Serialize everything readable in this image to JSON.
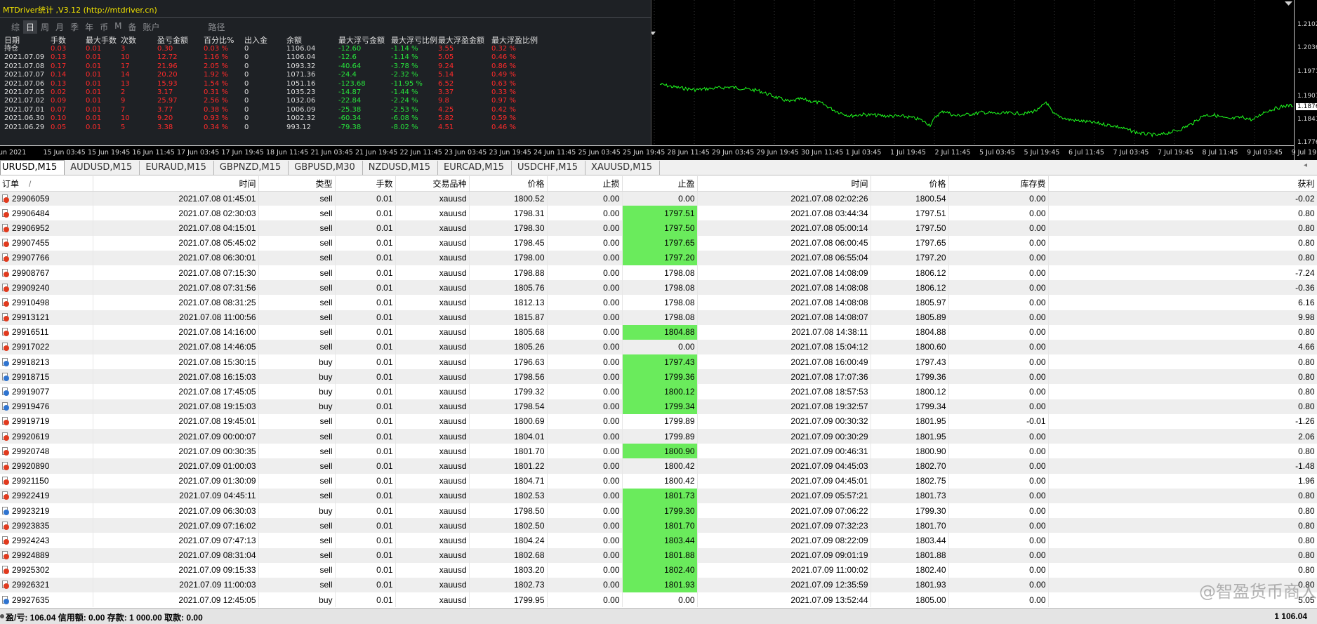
{
  "stats_panel": {
    "title": "MTDriver统计 ,V3.12 (http://mtdriver.cn)",
    "tabs": [
      "综",
      "日",
      "周",
      "月",
      "季",
      "年",
      "币",
      "M",
      "备",
      "账户"
    ],
    "active_tab": "日",
    "path_label": "路径",
    "headers": [
      "日期",
      "手数",
      "最大手数",
      "次数",
      "盈亏金额",
      "百分比%",
      "出入金",
      "余额",
      "最大浮亏金额",
      "最大浮亏比例",
      "最大浮盈金额",
      "最大浮盈比例"
    ],
    "rows": [
      [
        "持仓",
        "0.03",
        "0.01",
        "3",
        "0.30",
        "0.03 %",
        "0",
        "1106.04",
        "-12.60",
        "-1.14 %",
        "3.55",
        "0.32 %"
      ],
      [
        "2021.07.09",
        "0.13",
        "0.01",
        "10",
        "12.72",
        "1.16 %",
        "0",
        "1106.04",
        "-12.6",
        "-1.14 %",
        "5.05",
        "0.46 %"
      ],
      [
        "2021.07.08",
        "0.17",
        "0.01",
        "17",
        "21.96",
        "2.05 %",
        "0",
        "1093.32",
        "-40.64",
        "-3.78 %",
        "9.24",
        "0.86 %"
      ],
      [
        "2021.07.07",
        "0.14",
        "0.01",
        "14",
        "20.20",
        "1.92 %",
        "0",
        "1071.36",
        "-24.4",
        "-2.32 %",
        "5.14",
        "0.49 %"
      ],
      [
        "2021.07.06",
        "0.13",
        "0.01",
        "13",
        "15.93",
        "1.54 %",
        "0",
        "1051.16",
        "-123.68",
        "-11.95 %",
        "6.52",
        "0.63 %"
      ],
      [
        "2021.07.05",
        "0.02",
        "0.01",
        "2",
        "3.17",
        "0.31 %",
        "0",
        "1035.23",
        "-14.87",
        "-1.44 %",
        "3.37",
        "0.33 %"
      ],
      [
        "2021.07.02",
        "0.09",
        "0.01",
        "9",
        "25.97",
        "2.56 %",
        "0",
        "1032.06",
        "-22.84",
        "-2.24 %",
        "9.8",
        "0.97 %"
      ],
      [
        "2021.07.01",
        "0.07",
        "0.01",
        "7",
        "3.77",
        "0.38 %",
        "0",
        "1006.09",
        "-25.38",
        "-2.53 %",
        "4.25",
        "0.42 %"
      ],
      [
        "2021.06.30",
        "0.10",
        "0.01",
        "10",
        "9.20",
        "0.93 %",
        "0",
        "1002.32",
        "-60.34",
        "-6.08 %",
        "5.82",
        "0.59 %"
      ],
      [
        "2021.06.29",
        "0.05",
        "0.01",
        "5",
        "3.38",
        "0.34 %",
        "0",
        "993.12",
        "-79.38",
        "-8.02 %",
        "4.51",
        "0.46 %"
      ]
    ]
  },
  "chart": {
    "symbol_tab": "URUSD,M15",
    "line_color": "#1eff1e",
    "price_labels": [
      "1.2102",
      "1.2036",
      "1.1971",
      "1.1907",
      "1.1876",
      "1.1841",
      "1.1776"
    ],
    "current_price": "1.1876",
    "time_labels": [
      "un 2021",
      "15 Jun 03:45",
      "15 Jun 19:45",
      "16 Jun 11:45",
      "17 Jun 03:45",
      "17 Jun 19:45",
      "18 Jun 11:45",
      "21 Jun 03:45",
      "21 Jun 19:45",
      "22 Jun 11:45",
      "23 Jun 03:45",
      "23 Jun 19:45",
      "24 Jun 11:45",
      "25 Jun 03:45",
      "25 Jun 19:45",
      "28 Jun 11:45",
      "29 Jun 03:45",
      "29 Jun 19:45",
      "30 Jun 11:45",
      "1 Jul 03:45",
      "1 Jul 19:45",
      "2 Jul 11:45",
      "5 Jul 03:45",
      "5 Jul 19:45",
      "6 Jul 11:45",
      "7 Jul 03:45",
      "7 Jul 19:45",
      "8 Jul 11:45",
      "9 Jul 03:45",
      "9 Jul 19:45"
    ]
  },
  "chart_tabs": [
    "URUSD,M15",
    "AUDUSD,M15",
    "EURAUD,M15",
    "GBPNZD,M15",
    "GBPUSD,M30",
    "NZDUSD,M15",
    "EURCAD,M15",
    "USDCHF,M15",
    "XAUUSD,M15"
  ],
  "chart_tabs_arrow": "◂",
  "table": {
    "headers": [
      "订单",
      "时间",
      "类型",
      "手数",
      "交易品种",
      "价格",
      "止损",
      "止盈",
      "时间",
      "价格",
      "库存费",
      "获利"
    ],
    "sort_indicator": "/",
    "rows": [
      [
        "29906059",
        "2021.07.08 01:45:01",
        "sell",
        "0.01",
        "xauusd",
        "1800.52",
        "0.00",
        "0.00",
        "2021.07.08 02:02:26",
        "1800.54",
        "0.00",
        "-0.02"
      ],
      [
        "29906484",
        "2021.07.08 02:30:03",
        "sell",
        "0.01",
        "xauusd",
        "1798.31",
        "0.00",
        "1797.51",
        "2021.07.08 03:44:34",
        "1797.51",
        "0.00",
        "0.80"
      ],
      [
        "29906952",
        "2021.07.08 04:15:01",
        "sell",
        "0.01",
        "xauusd",
        "1798.30",
        "0.00",
        "1797.50",
        "2021.07.08 05:00:14",
        "1797.50",
        "0.00",
        "0.80"
      ],
      [
        "29907455",
        "2021.07.08 05:45:02",
        "sell",
        "0.01",
        "xauusd",
        "1798.45",
        "0.00",
        "1797.65",
        "2021.07.08 06:00:45",
        "1797.65",
        "0.00",
        "0.80"
      ],
      [
        "29907766",
        "2021.07.08 06:30:01",
        "sell",
        "0.01",
        "xauusd",
        "1798.00",
        "0.00",
        "1797.20",
        "2021.07.08 06:55:04",
        "1797.20",
        "0.00",
        "0.80"
      ],
      [
        "29908767",
        "2021.07.08 07:15:30",
        "sell",
        "0.01",
        "xauusd",
        "1798.88",
        "0.00",
        "1798.08",
        "2021.07.08 14:08:09",
        "1806.12",
        "0.00",
        "-7.24"
      ],
      [
        "29909240",
        "2021.07.08 07:31:56",
        "sell",
        "0.01",
        "xauusd",
        "1805.76",
        "0.00",
        "1798.08",
        "2021.07.08 14:08:08",
        "1806.12",
        "0.00",
        "-0.36"
      ],
      [
        "29910498",
        "2021.07.08 08:31:25",
        "sell",
        "0.01",
        "xauusd",
        "1812.13",
        "0.00",
        "1798.08",
        "2021.07.08 14:08:08",
        "1805.97",
        "0.00",
        "6.16"
      ],
      [
        "29913121",
        "2021.07.08 11:00:56",
        "sell",
        "0.01",
        "xauusd",
        "1815.87",
        "0.00",
        "1798.08",
        "2021.07.08 14:08:07",
        "1805.89",
        "0.00",
        "9.98"
      ],
      [
        "29916511",
        "2021.07.08 14:16:00",
        "sell",
        "0.01",
        "xauusd",
        "1805.68",
        "0.00",
        "1804.88",
        "2021.07.08 14:38:11",
        "1804.88",
        "0.00",
        "0.80"
      ],
      [
        "29917022",
        "2021.07.08 14:46:05",
        "sell",
        "0.01",
        "xauusd",
        "1805.26",
        "0.00",
        "0.00",
        "2021.07.08 15:04:12",
        "1800.60",
        "0.00",
        "4.66"
      ],
      [
        "29918213",
        "2021.07.08 15:30:15",
        "buy",
        "0.01",
        "xauusd",
        "1796.63",
        "0.00",
        "1797.43",
        "2021.07.08 16:00:49",
        "1797.43",
        "0.00",
        "0.80"
      ],
      [
        "29918715",
        "2021.07.08 16:15:03",
        "buy",
        "0.01",
        "xauusd",
        "1798.56",
        "0.00",
        "1799.36",
        "2021.07.08 17:07:36",
        "1799.36",
        "0.00",
        "0.80"
      ],
      [
        "29919077",
        "2021.07.08 17:45:05",
        "buy",
        "0.01",
        "xauusd",
        "1799.32",
        "0.00",
        "1800.12",
        "2021.07.08 18:57:53",
        "1800.12",
        "0.00",
        "0.80"
      ],
      [
        "29919476",
        "2021.07.08 19:15:03",
        "buy",
        "0.01",
        "xauusd",
        "1798.54",
        "0.00",
        "1799.34",
        "2021.07.08 19:32:57",
        "1799.34",
        "0.00",
        "0.80"
      ],
      [
        "29919719",
        "2021.07.08 19:45:01",
        "sell",
        "0.01",
        "xauusd",
        "1800.69",
        "0.00",
        "1799.89",
        "2021.07.09 00:30:32",
        "1801.95",
        "-0.01",
        "-1.26"
      ],
      [
        "29920619",
        "2021.07.09 00:00:07",
        "sell",
        "0.01",
        "xauusd",
        "1804.01",
        "0.00",
        "1799.89",
        "2021.07.09 00:30:29",
        "1801.95",
        "0.00",
        "2.06"
      ],
      [
        "29920748",
        "2021.07.09 00:30:35",
        "sell",
        "0.01",
        "xauusd",
        "1801.70",
        "0.00",
        "1800.90",
        "2021.07.09 00:46:31",
        "1800.90",
        "0.00",
        "0.80"
      ],
      [
        "29920890",
        "2021.07.09 01:00:03",
        "sell",
        "0.01",
        "xauusd",
        "1801.22",
        "0.00",
        "1800.42",
        "2021.07.09 04:45:03",
        "1802.70",
        "0.00",
        "-1.48"
      ],
      [
        "29921150",
        "2021.07.09 01:30:09",
        "sell",
        "0.01",
        "xauusd",
        "1804.71",
        "0.00",
        "1800.42",
        "2021.07.09 04:45:01",
        "1802.75",
        "0.00",
        "1.96"
      ],
      [
        "29922419",
        "2021.07.09 04:45:11",
        "sell",
        "0.01",
        "xauusd",
        "1802.53",
        "0.00",
        "1801.73",
        "2021.07.09 05:57:21",
        "1801.73",
        "0.00",
        "0.80"
      ],
      [
        "29923219",
        "2021.07.09 06:30:03",
        "buy",
        "0.01",
        "xauusd",
        "1798.50",
        "0.00",
        "1799.30",
        "2021.07.09 07:06:22",
        "1799.30",
        "0.00",
        "0.80"
      ],
      [
        "29923835",
        "2021.07.09 07:16:02",
        "sell",
        "0.01",
        "xauusd",
        "1802.50",
        "0.00",
        "1801.70",
        "2021.07.09 07:32:23",
        "1801.70",
        "0.00",
        "0.80"
      ],
      [
        "29924243",
        "2021.07.09 07:47:13",
        "sell",
        "0.01",
        "xauusd",
        "1804.24",
        "0.00",
        "1803.44",
        "2021.07.09 08:22:09",
        "1803.44",
        "0.00",
        "0.80"
      ],
      [
        "29924889",
        "2021.07.09 08:31:04",
        "sell",
        "0.01",
        "xauusd",
        "1802.68",
        "0.00",
        "1801.88",
        "2021.07.09 09:01:19",
        "1801.88",
        "0.00",
        "0.80"
      ],
      [
        "29925302",
        "2021.07.09 09:15:33",
        "sell",
        "0.01",
        "xauusd",
        "1803.20",
        "0.00",
        "1802.40",
        "2021.07.09 11:00:02",
        "1802.40",
        "0.00",
        "0.80"
      ],
      [
        "29926321",
        "2021.07.09 11:00:03",
        "sell",
        "0.01",
        "xauusd",
        "1802.73",
        "0.00",
        "1801.93",
        "2021.07.09 12:35:59",
        "1801.93",
        "0.00",
        "0.80"
      ],
      [
        "29927635",
        "2021.07.09 12:45:05",
        "buy",
        "0.01",
        "xauusd",
        "1799.95",
        "0.00",
        "0.00",
        "2021.07.09 13:52:44",
        "1805.00",
        "0.00",
        "5.05"
      ]
    ],
    "tp_highlight_color": "#6aeb5c"
  },
  "status_bar": {
    "text": "盈/亏: 106.04  信用额: 0.00  存款: 1 000.00  取款: 0.00",
    "total": "1 106.04"
  },
  "watermark": "@智盈货币商人"
}
